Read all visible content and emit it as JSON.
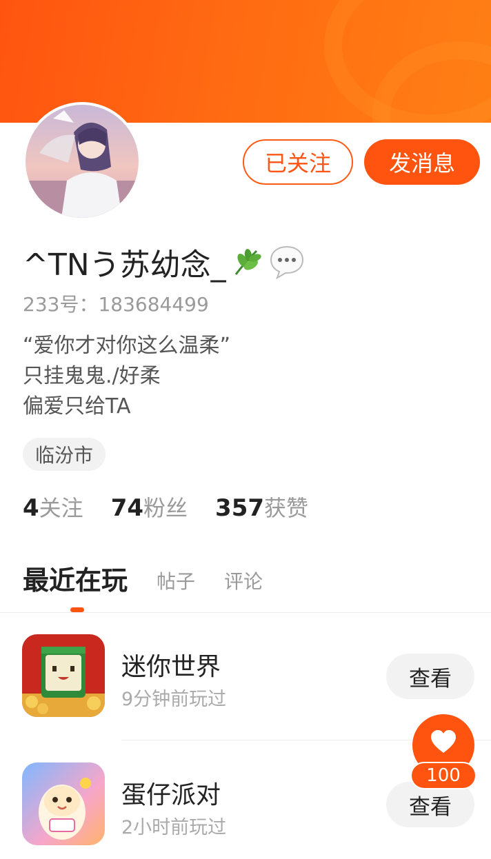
{
  "profile": {
    "name": "^TNう苏幼念_",
    "uid": "233号：183684499",
    "bio": [
      "“爱你才对你这么温柔”",
      "只挂鬼鬼./好柔",
      "偏爱只给TA"
    ],
    "city": "临汾市",
    "badge_icons": [
      "leaf-icon",
      "chat-bubble-icon"
    ]
  },
  "actions": {
    "follow_label": "已关注",
    "message_label": "发消息"
  },
  "stats": [
    {
      "num": "4",
      "label": "关注"
    },
    {
      "num": "74",
      "label": "粉丝"
    },
    {
      "num": "357",
      "label": "获赞"
    }
  ],
  "tabs": {
    "active": "最近在玩",
    "posts": "帖子",
    "comments": "评论"
  },
  "games": [
    {
      "title": "迷你世界",
      "sub": "9分钟前玩过",
      "button": "查看"
    },
    {
      "title": "蛋仔派对",
      "sub": "2小时前玩过",
      "button": "查看"
    }
  ],
  "like": {
    "count": "100"
  },
  "colors": {
    "accent": "#ff5410",
    "banner": "#ff6a12",
    "muted": "#9a9a9a"
  }
}
